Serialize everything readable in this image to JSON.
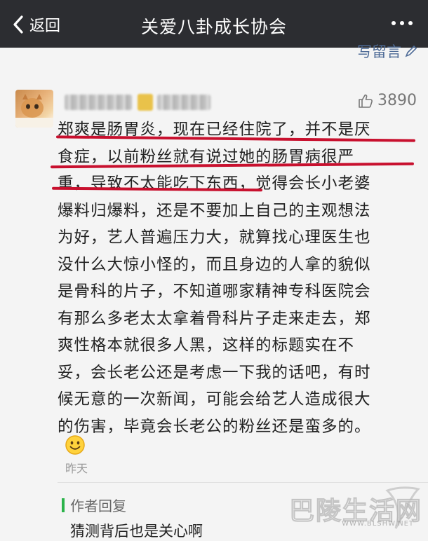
{
  "header": {
    "back_label": "返回",
    "title": "关爱八卦成长协会"
  },
  "write_comment_label": "写留言",
  "comment": {
    "likes": "3890",
    "lines": [
      "郑爽是肠胃炎，现在已经住院了，并不是厌",
      "食症，以前粉丝就有说过她的肠胃病很严",
      "重，导致不太能吃下东西，觉得会长小老婆",
      "爆料归爆料，还是不要加上自己的主观想法",
      "为好，艺人普遍压力大，就算找心理医生也",
      "没什么大惊小怪的，而且身边的人拿的貌似",
      "是骨科的片子，不知道哪家精神专科医院会",
      "有那么多老太太拿着骨科片子走来走去，郑",
      "爽性格本就很多人黑，这样的标题实在不",
      "妥，会长老公还是考虑一下我的话吧，有时",
      "候无意的一次新闻，可能会给艺人造成很大",
      "的伤害，毕竟会长老公的粉丝还是蛮多的。"
    ],
    "time": "昨天"
  },
  "reply": {
    "title": "作者回复",
    "text": "猜测背后也是关心啊"
  },
  "watermark": {
    "text": "巴陵生活网",
    "url": "WWW.BLSHW.NET"
  },
  "colors": {
    "topbar": "#2c2d31",
    "link": "#4e6b97",
    "underline": "#c8102e",
    "reply_accent": "#2bb34a"
  },
  "icons": {
    "back": "chevron-left-icon",
    "more": "more-dots-icon",
    "write": "pencil-icon",
    "like": "thumbs-up-icon",
    "emoji": "smiley-icon"
  }
}
